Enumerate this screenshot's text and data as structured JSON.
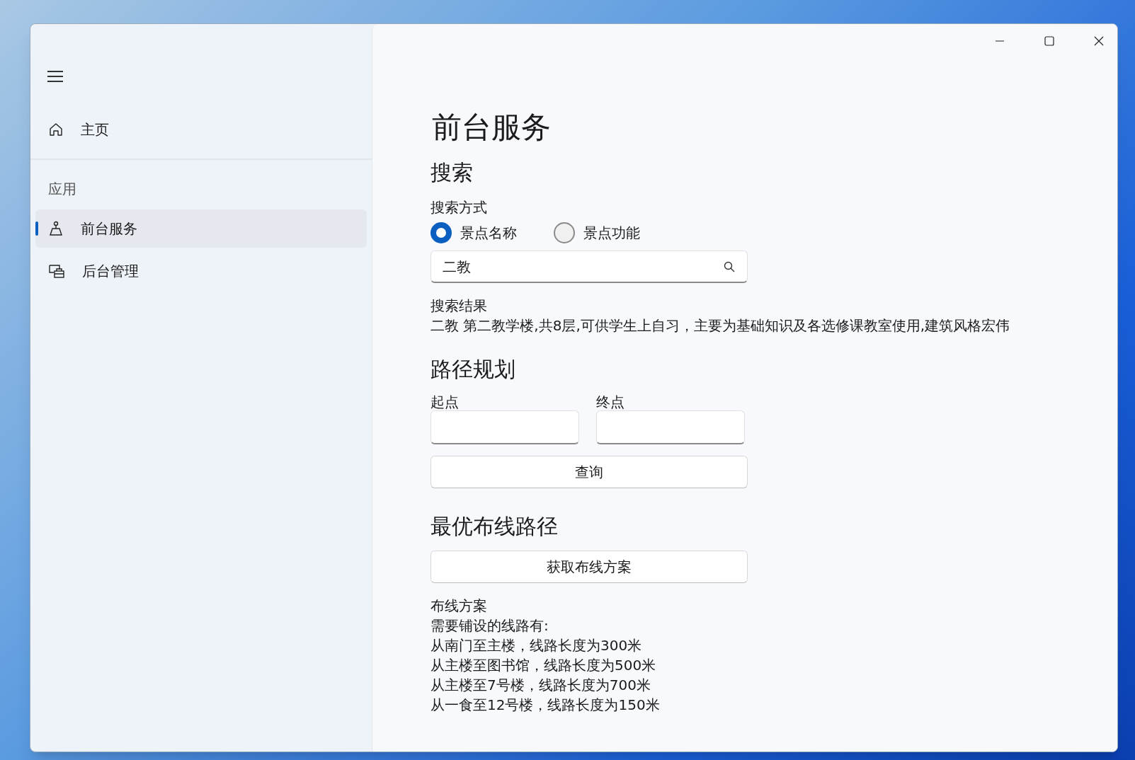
{
  "nav": {
    "items": [
      {
        "kind": "home",
        "label": "主页",
        "selected": false
      }
    ],
    "section_header": "应用",
    "section_items": [
      {
        "kind": "person",
        "label": "前台服务",
        "selected": true
      },
      {
        "kind": "admin",
        "label": "后台管理",
        "selected": false
      }
    ]
  },
  "page": {
    "title": "前台服务",
    "search": {
      "heading": "搜索",
      "mode_label": "搜索方式",
      "modes": [
        {
          "label": "景点名称",
          "selected": true
        },
        {
          "label": "景点功能",
          "selected": false
        }
      ],
      "value": "二教",
      "result_label": "搜索结果",
      "result_text": "二教 第二教学楼,共8层,可供学生上自习，主要为基础知识及各选修课教室使用,建筑风格宏伟"
    },
    "route": {
      "heading": "路径规划",
      "fields": [
        {
          "label": "起点"
        },
        {
          "label": "终点"
        }
      ],
      "button": "查询"
    },
    "wiring": {
      "heading": "最优布线路径",
      "button": "获取布线方案",
      "result_label": "布线方案",
      "lines": [
        "需要铺设的线路有:",
        "从南门至主楼，线路长度为300米",
        "从主楼至图书馆，线路长度为500米",
        "从主楼至7号楼，线路长度为700米",
        "从一食至12号楼，线路长度为150米"
      ]
    }
  }
}
